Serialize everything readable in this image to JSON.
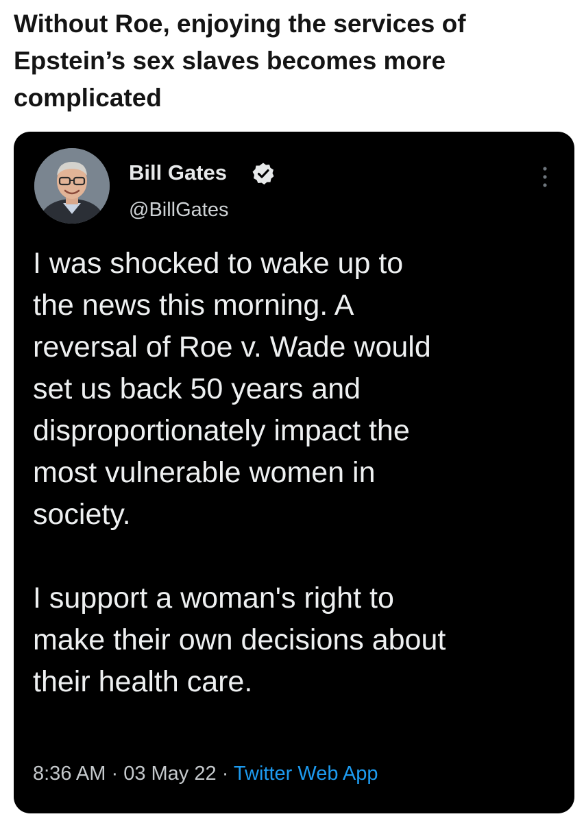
{
  "caption": "Without Roe, enjoying the services of\nEpstein’s sex slaves becomes more\ncomplicated",
  "tweet": {
    "author": {
      "display_name": "Bill Gates",
      "handle": "@BillGates",
      "verified": true,
      "avatar_icon": "profile-photo"
    },
    "body": [
      "I was shocked to wake up to\nthe news this morning. A\nreversal of Roe v. Wade would\nset us back 50 years and\ndisproportionately impact the\nmost vulnerable women in\nsociety.",
      "I support a woman's right to\nmake their own decisions about\ntheir health care."
    ],
    "time": "8:36 AM",
    "date": "03 May 22",
    "separator": "·",
    "source": "Twitter Web App"
  },
  "colors": {
    "card_background": "#000000",
    "link_blue": "#1d9bf0",
    "page_background": "#ffffff"
  }
}
